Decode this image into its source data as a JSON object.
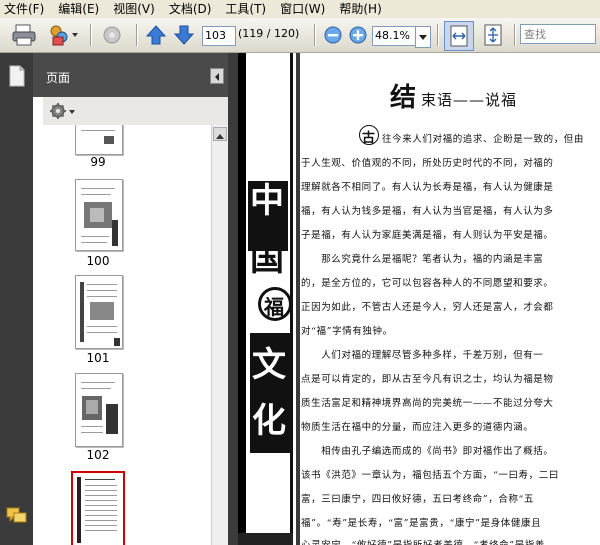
{
  "menu": [
    "文件(F)",
    "编辑(E)",
    "视图(V)",
    "文档(D)",
    "工具(T)",
    "窗口(W)",
    "帮助(H)"
  ],
  "toolbar": {
    "page_number": "103",
    "page_count": "(119 / 120)",
    "zoom": "48.1%",
    "search_placeholder": "查找"
  },
  "panel": {
    "title": "页面"
  },
  "thumbnails": [
    {
      "label": "99"
    },
    {
      "label": "100"
    },
    {
      "label": "101"
    },
    {
      "label": "102"
    },
    {
      "label": ""
    }
  ],
  "left_page": {
    "vertical_title_chars": [
      "中",
      "国",
      "福",
      "文",
      "化"
    ]
  },
  "document": {
    "title_big": "结",
    "title_rest": "束语——说福",
    "drop_cap": "古",
    "lines": [
      "往今来人们对福的追求、企盼是一致的，但由",
      "于人生观、价值观的不同，所处历史时代的不同，对福的",
      "理解就各不相同了。有人认为长寿是福，有人认为健康是",
      "福，有人认为钱多是福，有人认为当官是福，有人认为多",
      "子是福，有人认为家庭美满是福，有人则认为平安是福。",
      "　　那么究竟什么是福呢？笔者认为，福的内涵是丰富",
      "的，是全方位的，它可以包容各种人的不同愿望和要求。",
      "正因为如此，不管古人还是今人，穷人还是富人，才会都",
      "对“福”字情有独钟。",
      "　　人们对福的理解尽管多种多样，千差万别，但有一",
      "点是可以肯定的，即从古至今凡有识之士，均认为福是物",
      "质生活富足和精神境界高尚的完美统一——不能过分夸大",
      "物质生活在福中的分量，而应注入更多的道德内涵。",
      "　　相传由孔子编选而成的《尚书》即对福作出了概括。",
      "该书《洪范》一章认为，福包括五个方面，“一曰寿，二曰",
      "富，三曰康宁，四曰攸好德，五曰考终命”，合称“五",
      "福”。“寿”是长寿，“富”是富贵，“康宁”是身体健康且",
      "心灵安宁，“攸好德”是指所好者美德，“考终命”是指善"
    ]
  }
}
